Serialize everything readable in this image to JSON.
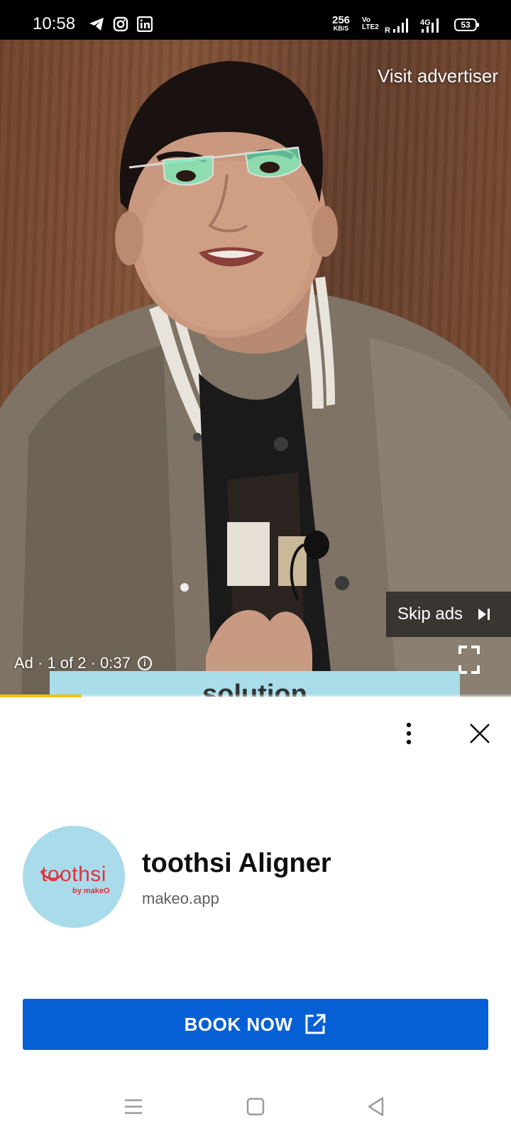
{
  "status_bar": {
    "time": "10:58",
    "app_icons": [
      "telegram-icon",
      "instagram-icon",
      "linkedin-icon"
    ],
    "net_speed_value": "256",
    "net_speed_unit": "KB/S",
    "volte": "Vo LTE2",
    "roaming": "R",
    "network_type": "4G",
    "battery": "53"
  },
  "video": {
    "visit_advertiser": "Visit advertiser",
    "skip_label": "Skip ads",
    "ad_info": "Ad · 1 of 2 · 0:37",
    "caption": "solution",
    "progress_fraction": 0.16,
    "progress_color": "#f4c20d"
  },
  "ad": {
    "logo_text": "toothsi",
    "logo_subtext": "by makeO",
    "title": "toothsi Aligner",
    "domain": "makeo.app",
    "cta_label": "BOOK NOW",
    "cta_color": "#065fd4"
  },
  "navbar": {
    "items": [
      "menu-icon",
      "home-icon",
      "back-icon"
    ]
  }
}
